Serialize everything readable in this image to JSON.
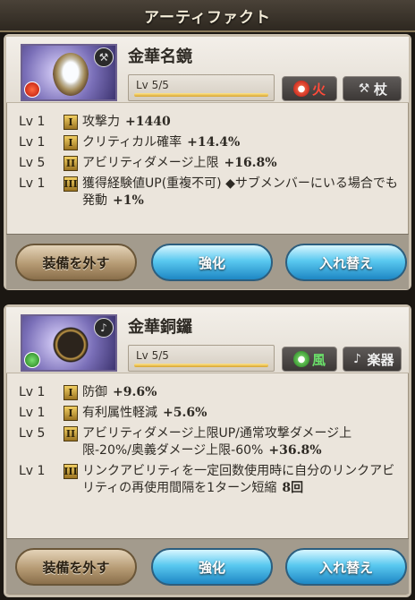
{
  "header": {
    "title": "アーティファクト"
  },
  "artifacts": [
    {
      "name": "金華名鏡",
      "level_text": "Lv 5/5",
      "level_fraction": 1.0,
      "element_label": "火",
      "weapon_label": "杖",
      "element_icon": "fire-icon",
      "weapon_icon": "staff-icon",
      "skills": [
        {
          "lv": "Lv 1",
          "tier": "I",
          "desc": "攻撃力",
          "value": "+1440"
        },
        {
          "lv": "Lv 1",
          "tier": "I",
          "desc": "クリティカル確率",
          "value": "+14.4%"
        },
        {
          "lv": "Lv 5",
          "tier": "II",
          "desc": "アビリティダメージ上限",
          "value": "+16.8%"
        },
        {
          "lv": "Lv 1",
          "tier": "III",
          "desc": "獲得経験値UP(重複不可) ◆サブメンバーにいる場合でも発動",
          "value": "+1%"
        }
      ],
      "buttons": {
        "remove": "装備を外す",
        "upgrade": "強化",
        "swap": "入れ替え"
      }
    },
    {
      "name": "金華銅鑼",
      "level_text": "Lv 5/5",
      "level_fraction": 1.0,
      "element_label": "風",
      "weapon_label": "楽器",
      "element_icon": "wind-icon",
      "weapon_icon": "instrument-icon",
      "skills": [
        {
          "lv": "Lv 1",
          "tier": "I",
          "desc": "防御",
          "value": "+9.6%"
        },
        {
          "lv": "Lv 1",
          "tier": "I",
          "desc": "有利属性軽減",
          "value": "+5.6%"
        },
        {
          "lv": "Lv 5",
          "tier": "II",
          "desc": "アビリティダメージ上限UP/通常攻撃ダメージ上限-20%/奥義ダメージ上限-60%",
          "value": "+36.8%"
        },
        {
          "lv": "Lv 1",
          "tier": "III",
          "desc": "リンクアビリティを一定回数使用時に自分のリンクアビリティの再使用間隔を1ターン短縮",
          "value": "8回"
        }
      ],
      "buttons": {
        "remove": "装備を外す",
        "upgrade": "強化",
        "swap": "入れ替え"
      }
    }
  ]
}
